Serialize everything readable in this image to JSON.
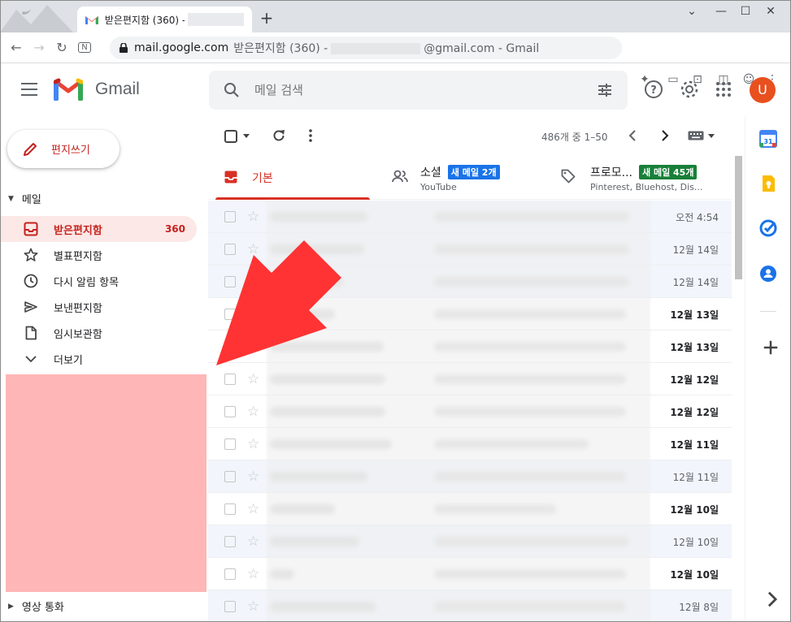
{
  "browser": {
    "tab_title": "받은편지함 (360) -",
    "address_domain": "mail.google.com",
    "address_rest_prefix": "받은편지함 (360) -",
    "address_rest_suffix": "@gmail.com - Gmail"
  },
  "gmail": {
    "logo_text": "Gmail",
    "search_placeholder": "메일 검색",
    "avatar_letter": "U"
  },
  "sidebar": {
    "compose_label": "편지쓰기",
    "mail_section": "메일",
    "items": [
      {
        "label": "받은편지함",
        "count": "360",
        "icon": "inbox-icon"
      },
      {
        "label": "별표편지함",
        "count": "",
        "icon": "star-icon"
      },
      {
        "label": "다시 알림 항목",
        "count": "",
        "icon": "clock-icon"
      },
      {
        "label": "보낸편지함",
        "count": "",
        "icon": "send-icon"
      },
      {
        "label": "임시보관함",
        "count": "",
        "icon": "draft-icon"
      },
      {
        "label": "더보기",
        "count": "",
        "icon": "chevron-down-icon"
      }
    ],
    "video_section": "영상 통화"
  },
  "toolbar": {
    "pager": "486개 중 1–50"
  },
  "tabs": [
    {
      "name": "기본",
      "sub": "",
      "badge": "",
      "badge_color": ""
    },
    {
      "name": "소셜",
      "sub": "YouTube",
      "badge": "새 메일 2개",
      "badge_color": "#1a73e8"
    },
    {
      "name": "프로모...",
      "sub": "Pinterest, Bluehost, Dis...",
      "badge": "새 메일 45개",
      "badge_color": "#188038"
    }
  ],
  "emails": [
    {
      "date": "오전 4:54",
      "unread": false
    },
    {
      "date": "12월 14일",
      "unread": false
    },
    {
      "date": "12월 14일",
      "unread": false
    },
    {
      "date": "12월 13일",
      "unread": true
    },
    {
      "date": "12월 13일",
      "unread": true
    },
    {
      "date": "12월 12일",
      "unread": true
    },
    {
      "date": "12월 12일",
      "unread": true
    },
    {
      "date": "12월 11일",
      "unread": true
    },
    {
      "date": "12월 11일",
      "unread": false
    },
    {
      "date": "12월 10일",
      "unread": true
    },
    {
      "date": "12월 10일",
      "unread": false
    },
    {
      "date": "12월 10일",
      "unread": true
    },
    {
      "date": "12월 8일",
      "unread": false
    }
  ],
  "colors": {
    "accent_red": "#d93025",
    "highlight_pink": "#feb6b6",
    "arrow_red": "#ff3333"
  }
}
